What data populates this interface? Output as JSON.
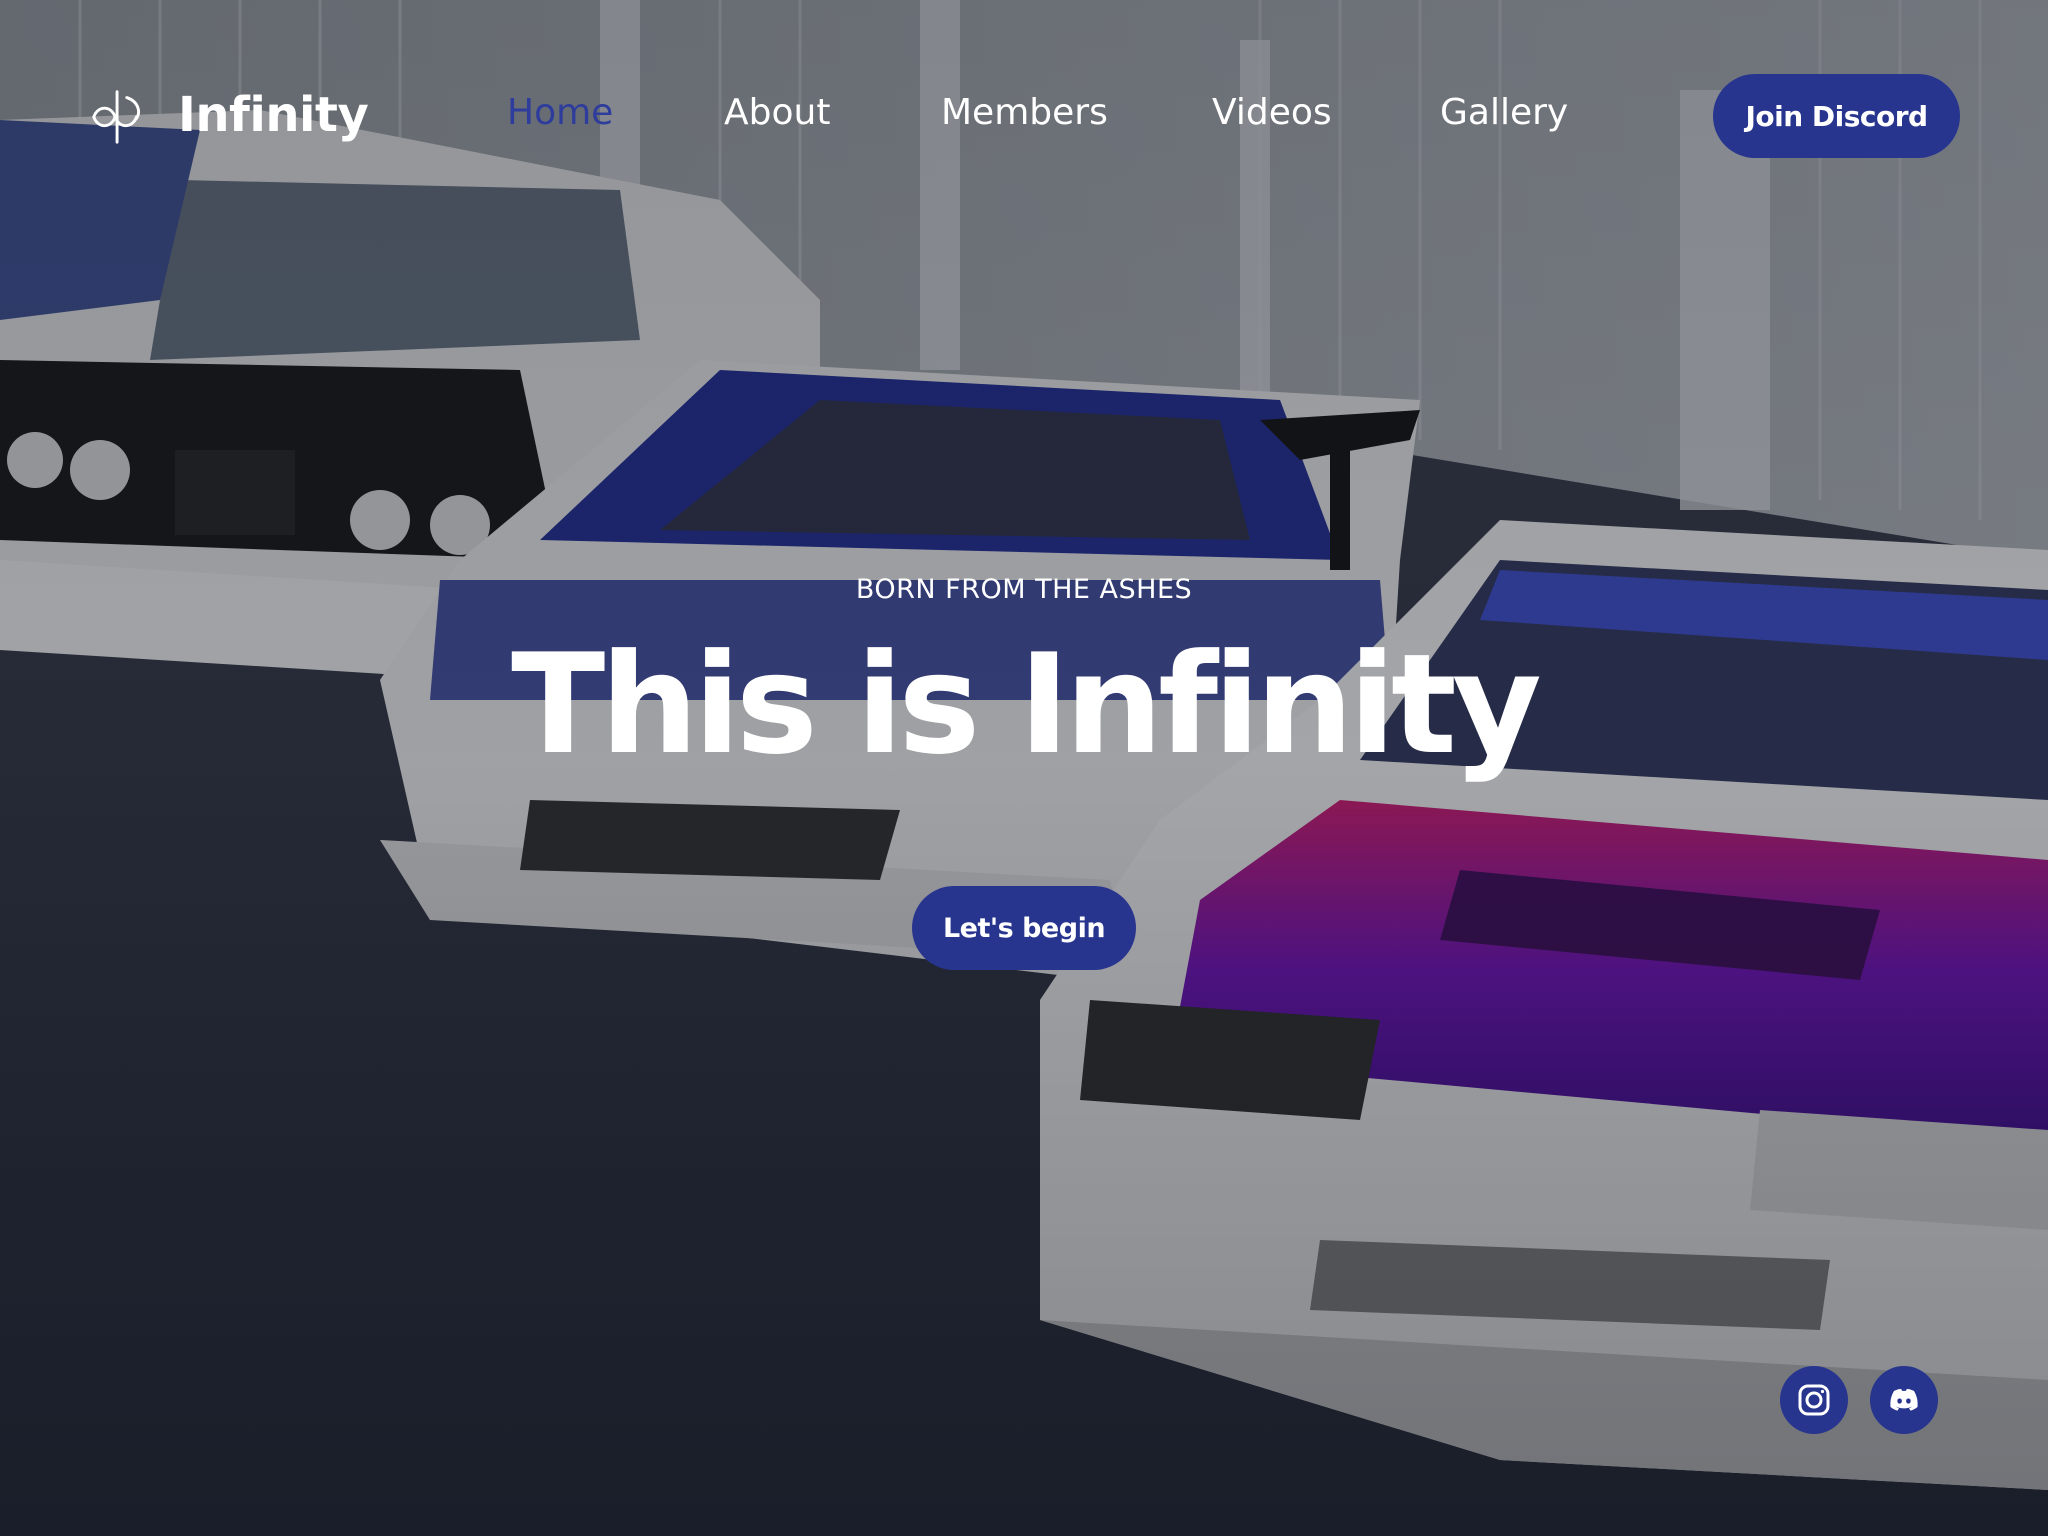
{
  "brand": {
    "name": "Infinity",
    "logo_icon": "infinity-logo-icon"
  },
  "nav": {
    "items": [
      {
        "label": "Home",
        "active": true
      },
      {
        "label": "About",
        "active": false
      },
      {
        "label": "Members",
        "active": false
      },
      {
        "label": "Videos",
        "active": false
      },
      {
        "label": "Gallery",
        "active": false
      }
    ],
    "join_label": "Join Discord"
  },
  "hero": {
    "kicker": "BORN FROM THE ASHES",
    "title": "This is Infinity",
    "cta_label": "Let's begin"
  },
  "social": {
    "icons": [
      "instagram-icon",
      "discord-icon"
    ]
  },
  "colors": {
    "accent": "#27358f",
    "nav_active": "#2e3c9c",
    "text": "#ffffff"
  }
}
